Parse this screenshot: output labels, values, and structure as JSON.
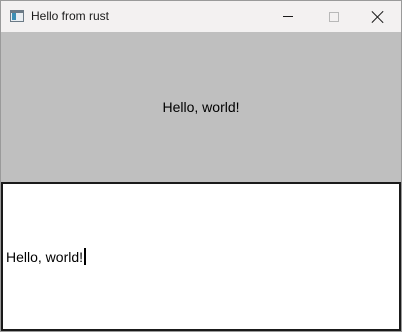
{
  "window": {
    "title": "Hello from rust",
    "icon": "app-window-icon",
    "controls": {
      "minimize_icon": "minimize-icon",
      "maximize_icon": "maximize-icon",
      "close_icon": "close-icon"
    }
  },
  "label_pane": {
    "text": "Hello, world!",
    "background": "#bfbfbf"
  },
  "editor": {
    "value": "Hello, world!"
  }
}
